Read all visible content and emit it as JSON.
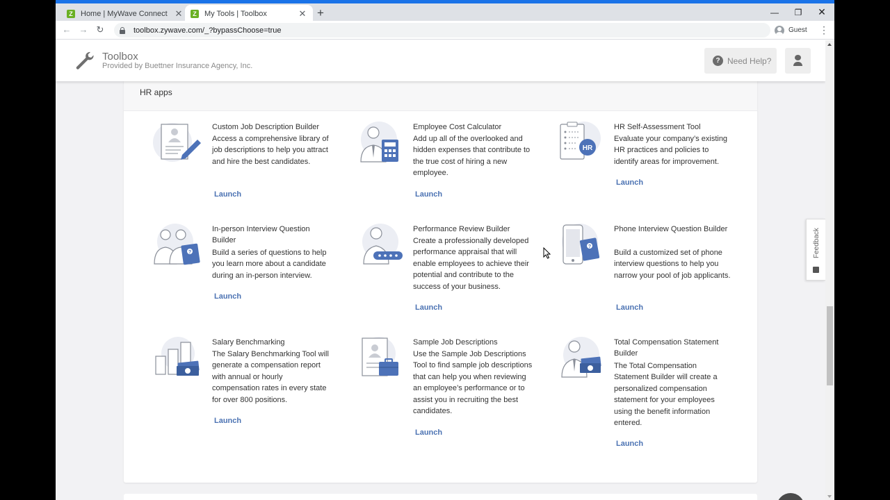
{
  "browser": {
    "tabs": [
      {
        "title": "Home | MyWave Connect",
        "favicon": "Z",
        "active": false
      },
      {
        "title": "My Tools | Toolbox",
        "favicon": "Z",
        "active": true
      }
    ],
    "new_tab_icon": "plus-icon",
    "url": "toolbox.zywave.com/_?bypassChoose=true",
    "profile_label": "Guest",
    "accent_color": "#1a73e8"
  },
  "header": {
    "title": "Toolbox",
    "subtitle": "Provided by Buettner Insurance Agency, Inc.",
    "help_label": "Need Help?",
    "help_icon": "?"
  },
  "section": {
    "title": "HR apps",
    "launch_label": "Launch",
    "apps": [
      {
        "name": "Custom Job Description Builder",
        "description": "Access a comprehensive library of job descriptions to help you attract and hire the best candidates.",
        "icon": "document-pencil-icon"
      },
      {
        "name": "Employee Cost Calculator",
        "description": "Add up all of the overlooked and hidden expenses that contribute to the true cost of hiring a new employee.",
        "icon": "person-calculator-icon"
      },
      {
        "name": "HR Self-Assessment Tool",
        "description": "Evaluate your company’s existing HR practices and policies to identify areas for improvement.",
        "icon": "clipboard-hr-icon",
        "badge": "HR"
      },
      {
        "name": "In-person Interview Question Builder",
        "description": "Build a series of questions to help you learn more about a candidate during an in-person interview.",
        "icon": "two-people-question-icon"
      },
      {
        "name": "Performance Review Builder",
        "description": "Create a professionally developed performance appraisal that will enable employees to achieve their potential and contribute to the success of your business.",
        "icon": "person-rating-icon"
      },
      {
        "name": "Phone Interview Question Builder",
        "description": "Build a customized set of phone interview questions to help you narrow your pool of job applicants.",
        "icon": "phone-question-icon"
      },
      {
        "name": "Salary Benchmarking",
        "description": "The Salary Benchmarking Tool will generate a compensation report with annual or hourly compensation rates in every state for over 800 positions.",
        "icon": "bar-chart-money-icon"
      },
      {
        "name": "Sample Job Descriptions",
        "description": "Use the Sample Job Descriptions Tool to find sample job descriptions that can help you when reviewing an employee’s performance or to assist you in recruiting the best candidates.",
        "icon": "document-briefcase-icon"
      },
      {
        "name": "Total Compensation Statement Builder",
        "description": "The Total Compensation Statement Builder will create a personalized compensation statement for your employees using the benefit information entered.",
        "icon": "person-money-icon"
      }
    ]
  },
  "feedback_label": "Feedback",
  "colors": {
    "link": "#4c73b3",
    "icon_blue": "#4d72b8",
    "favicon_green": "#6ab023"
  }
}
